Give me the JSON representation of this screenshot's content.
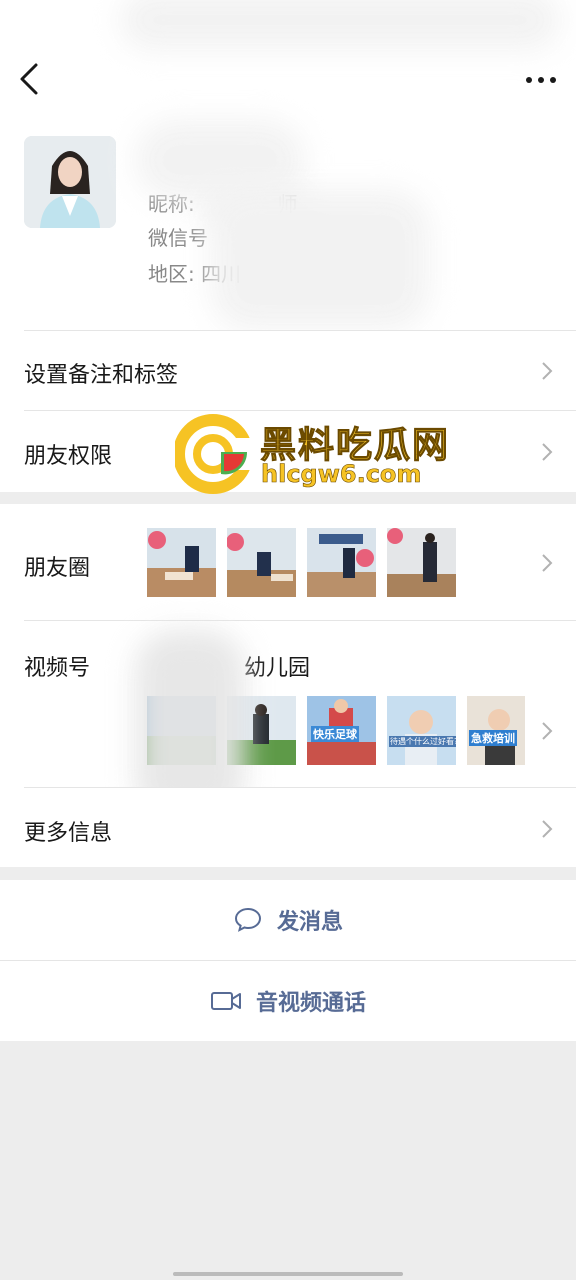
{
  "nav": {
    "back_icon": "chevron-left-icon",
    "more_icon": "more-dots-icon"
  },
  "profile": {
    "nickname_label": "昵称:",
    "nickname_value_tail": "师",
    "wechat_id_label": "微信号",
    "region_label": "地区:",
    "region_value": "四川"
  },
  "rows": {
    "remarks": "设置备注和标签",
    "permissions": "朋友权限",
    "moments": "朋友圈",
    "channels": "视频号",
    "channels_name_tail": "幼儿园",
    "more_info": "更多信息"
  },
  "moments_thumbs": [
    "photo-cpr-1",
    "photo-cpr-2",
    "photo-cpr-3",
    "photo-cpr-4"
  ],
  "channels_thumbs": [
    {
      "caption": ""
    },
    {
      "caption": ""
    },
    {
      "caption": "快乐足球"
    },
    {
      "caption": "待遇个什么过好看?"
    },
    {
      "caption": "急救培训"
    }
  ],
  "actions": {
    "message": "发消息",
    "message_icon": "chat-bubble-icon",
    "call": "音视频通话",
    "call_icon": "video-camera-icon"
  },
  "watermark": {
    "title": "黑料吃瓜网",
    "url": "hlcgw6.com"
  },
  "colors": {
    "link": "#576b95",
    "accent_yellow": "#f6c324",
    "background": "#ededed"
  }
}
